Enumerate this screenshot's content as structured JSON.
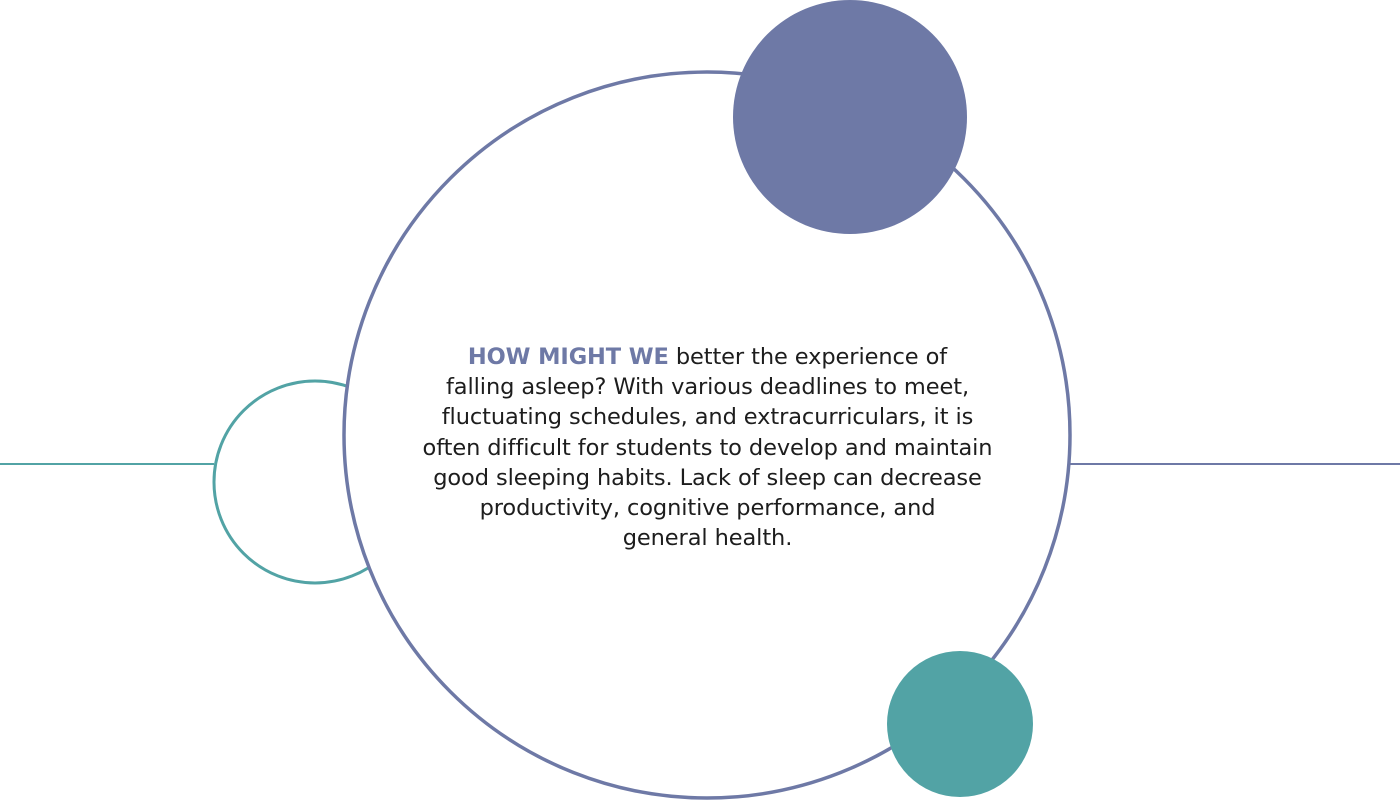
{
  "colors": {
    "slate": "#6e79a6",
    "teal": "#52a3a5",
    "background": "#ffffff",
    "text": "#1d1d1d"
  },
  "statement": {
    "lead": "HOW MIGHT WE",
    "lines": [
      " better the experience of",
      "falling asleep? With various deadlines to meet,",
      "fluctuating schedules, and extracurriculars, it is",
      "often difficult for students to develop and maintain",
      "good sleeping habits. Lack of sleep can decrease",
      "productivity, cognitive performance, and",
      "general health."
    ]
  }
}
